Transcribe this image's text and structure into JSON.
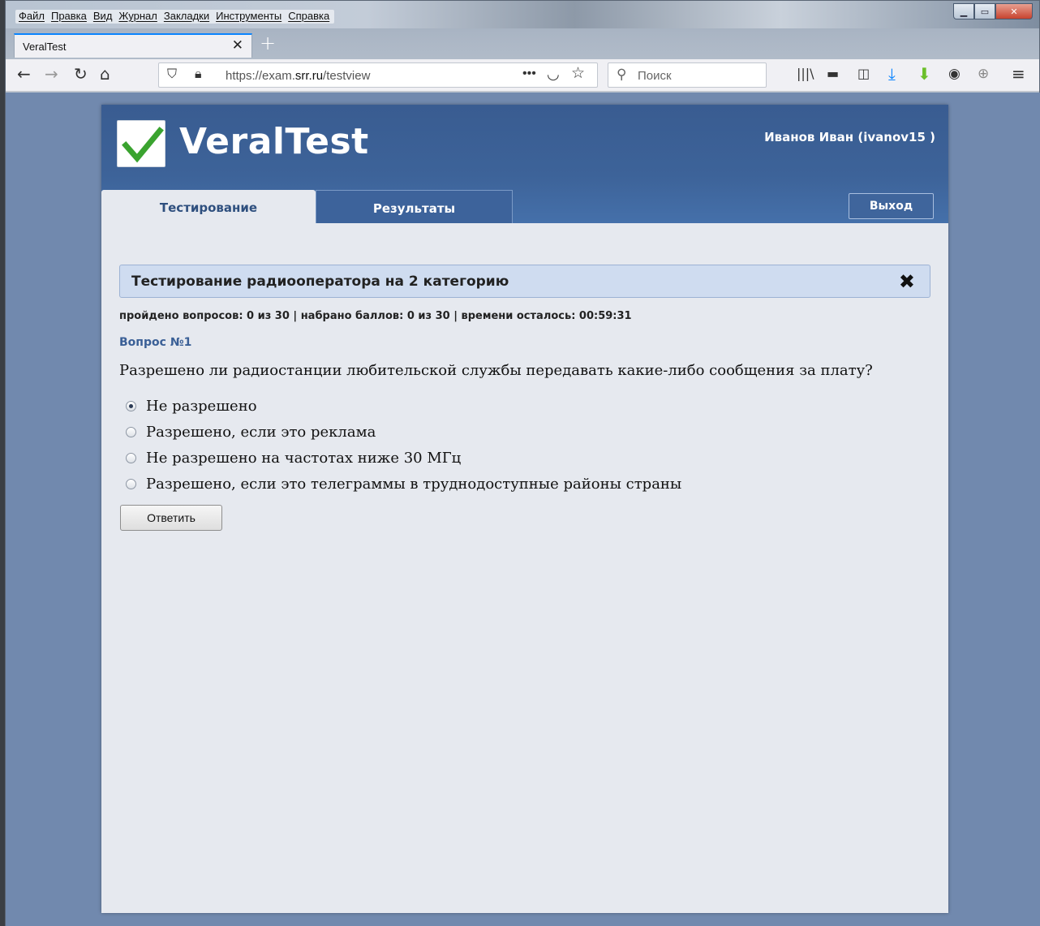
{
  "browser": {
    "menu": [
      "Файл",
      "Правка",
      "Вид",
      "Журнал",
      "Закладки",
      "Инструменты",
      "Справка"
    ],
    "tab_title": "VeralTest",
    "url_prefix": "https://exam.",
    "url_domain": "srr.ru",
    "url_path": "/testview",
    "search_placeholder": "Поиск",
    "accent": "#0a84ff"
  },
  "app": {
    "logo_text": "VeralTest",
    "user": "Иванов Иван (ivanov15 )",
    "tabs": [
      {
        "label": "Тестирование",
        "active": true
      },
      {
        "label": "Результаты",
        "active": false
      }
    ],
    "logout_label": "Выход",
    "header_color": "#3d6399"
  },
  "test": {
    "title": "Тестирование радиооператора на 2 категорию",
    "stats": "пройдено вопросов: 0 из 30 | набрано баллов: 0 из 30 | времени осталось: 00:59:31",
    "question_number": "Вопрос №1",
    "question": "Разрешено ли радиостанции любительской службы передавать какие-либо сообщения за плату?",
    "answers": [
      {
        "label": "Не разрешено",
        "selected": true
      },
      {
        "label": "Разрешено, если это реклама",
        "selected": false
      },
      {
        "label": "Не разрешено на частотах ниже 30 МГц",
        "selected": false
      },
      {
        "label": "Разрешено, если это телеграммы в труднодоступные районы страны",
        "selected": false
      }
    ],
    "submit_label": "Ответить"
  }
}
